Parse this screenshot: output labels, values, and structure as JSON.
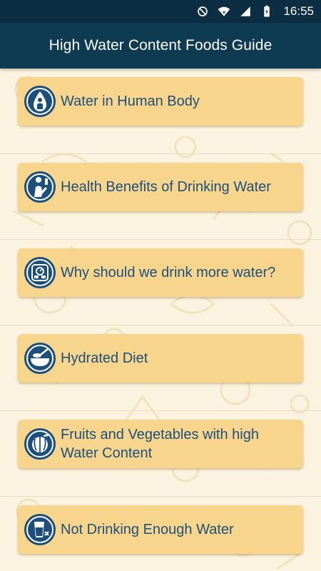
{
  "status_bar": {
    "time": "16:55",
    "icons": [
      "do-not-disturb-icon",
      "wifi-icon",
      "signal-icon",
      "battery-icon"
    ]
  },
  "app_bar": {
    "title": "High Water Content Foods Guide"
  },
  "menu": {
    "items": [
      {
        "label": "Water in Human Body",
        "icon": "water-drop-person-icon"
      },
      {
        "label": "Health Benefits of Drinking Water",
        "icon": "person-drinking-icon"
      },
      {
        "label": "Why should we drink more water?",
        "icon": "bathroom-scale-icon"
      },
      {
        "label": "Hydrated Diet",
        "icon": "bowl-icon"
      },
      {
        "label": "Fruits and Vegetables with high Water Content",
        "icon": "watermelon-icon"
      },
      {
        "label": "Not Drinking Enough Water",
        "icon": "water-glass-icon"
      }
    ]
  },
  "colors": {
    "status_bar": "#0c2d42",
    "app_bar": "#0e3a52",
    "background": "#fbf3df",
    "card": "#f8d58c",
    "label_text": "#1d4f7c",
    "icon_fill": "#1d4f7c"
  }
}
